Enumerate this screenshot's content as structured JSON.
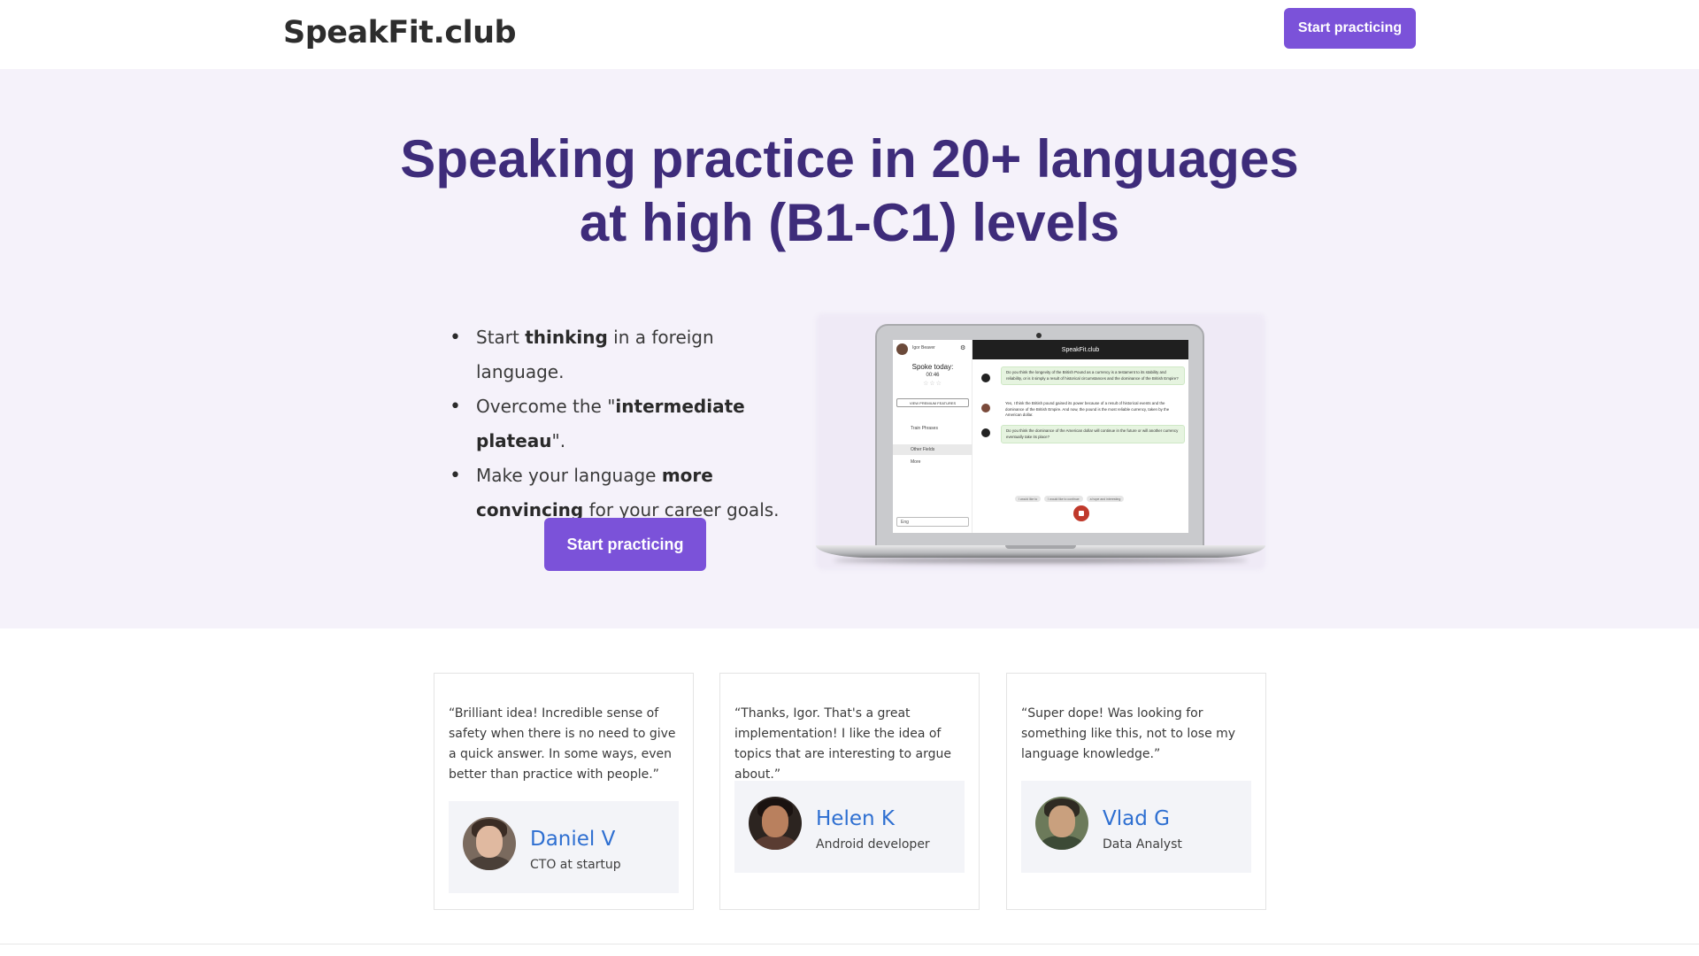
{
  "header": {
    "logo": "SpeakFit.club",
    "cta_label": "Start practicing"
  },
  "hero": {
    "title_line1": "Speaking practice in 20+ languages",
    "title_line2": "at high (B1-C1) levels",
    "bullets": [
      {
        "pre": "Start ",
        "bold": "thinking",
        "post": " in a foreign language."
      },
      {
        "pre": "Overcome the \"",
        "bold": "intermediate plateau",
        "post": "\"."
      },
      {
        "pre": "Make your language ",
        "bold": "more convincing",
        "post": " for your career goals."
      }
    ],
    "cta_label": "Start practicing"
  },
  "app_preview": {
    "user_name": "Igor Beaver",
    "app_title": "SpeakFit.club",
    "spoke_today_label": "Spoke today:",
    "spoke_today_time": "00:46",
    "premium_label": "VIEW PREMIUM FEATURES",
    "menu_items": [
      "Train Phrases",
      "Other Fields",
      "More"
    ],
    "language_select": "Eng",
    "messages": [
      "Do you think the longevity of the British Pound as a currency is a testament to its stability and reliability, or is it simply a result of historical circumstances and the dominance of the British Empire?",
      "Yes, I think the British pound gained its power because of a result of historical events and the dominance of the British Empire. And now, the pound is the most reliable currency, taken by the American dollar.",
      "Do you think the dominance of the American dollar will continue in the future or will another currency eventually take its place?"
    ],
    "suggestion_chips": [
      "I would like to",
      "I would like to continue",
      "a hope and interesting"
    ]
  },
  "testimonials": [
    {
      "quote": "“Brilliant idea! Incredible sense of safety when there is no need to give a quick answer. In some ways, even better than practice with people.”",
      "name": "Daniel V",
      "role": "CTO at startup"
    },
    {
      "quote": "“Thanks, Igor. That's a great implementation! I like the idea of topics that are interesting to argue about.”",
      "name": "Helen K",
      "role": "Android developer"
    },
    {
      "quote": "“Super dope! Was looking for something like this, not to lose my language knowledge.”",
      "name": "Vlad G",
      "role": "Data Analyst"
    }
  ],
  "colors": {
    "accent": "#7b52d9",
    "title": "#3e2c7a",
    "hero_bg": "#f5f2fa",
    "name_link": "#2e6fd1"
  }
}
